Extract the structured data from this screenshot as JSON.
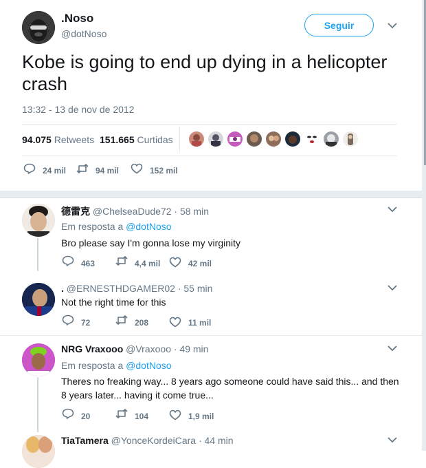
{
  "tweet": {
    "display_name": ".Noso",
    "handle": "@dotNoso",
    "follow_label": "Seguir",
    "text": "Kobe is going to end up dying in a helicopter crash",
    "timestamp": "13:32 - 13 de nov de 2012",
    "retweets_count": "94.075",
    "retweets_label": "Retweets",
    "likes_count": "151.665",
    "likes_label": "Curtidas",
    "reply_count": "24 mil",
    "retweet_count": "94 mil",
    "like_count": "152 mil"
  },
  "replies": [
    {
      "name": "德雷克",
      "handle": "@ChelseaDude72",
      "time": "58 min",
      "reply_prefix": "Em resposta a",
      "reply_to": "@dotNoso",
      "text": "Bro please say I'm gonna lose my virginity",
      "replies": "463",
      "retweets": "4,4 mil",
      "likes": "42 mil"
    },
    {
      "name": ".",
      "handle": "@ERNESTHDGAMER02",
      "time": "55 min",
      "text": "Not the right time for this",
      "replies": "72",
      "retweets": "208",
      "likes": "11 mil"
    },
    {
      "name": "NRG Vraxooo",
      "handle": "@Vraxooo",
      "time": "49 min",
      "reply_prefix": "Em resposta a",
      "reply_to": "@dotNoso",
      "text_line1": "Theres no freaking way... 8 years ago someone could have said this... and then",
      "text_line2": "8 years later... having it come true...",
      "replies": "20",
      "retweets": "104",
      "likes": "1,9 mil"
    },
    {
      "name": "TiaTamera",
      "handle": "@YonceKordeiCara",
      "time": "44 min"
    }
  ],
  "separator": "·",
  "colors": {
    "accent": "#1da1f2",
    "muted": "#657786",
    "text": "#14171a",
    "border": "#e6ecf0"
  }
}
